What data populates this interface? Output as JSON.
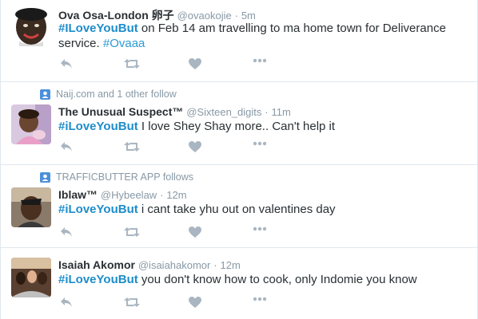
{
  "colors": {
    "text": "#292f33",
    "muted": "#8899a6",
    "hashtag": "#1d8dca",
    "icon": "#a9b6c1",
    "context_icon": "#4a90d9"
  },
  "tweets": [
    {
      "fullname": "Ova Osa-London 卵子",
      "username": "@ovaokojie",
      "dot": "·",
      "time": "5m",
      "hashtag": "#ILoveYouBut",
      "text": " on Feb 14 am travelling to ma home town for Deliverance service.  ",
      "hashtag2": "#Ovaaa",
      "icons": [
        "reply-icon",
        "retweet-icon",
        "favorite-icon",
        "more-icon"
      ]
    },
    {
      "context": "Naij.com and 1 other follow",
      "fullname": "The Unusual Suspect™",
      "username": "@Sixteen_digits",
      "dot": "·",
      "time": "11m",
      "hashtag": "#iLoveYouBut",
      "text": " I love Shey Shay more.. Can't help it",
      "icons": [
        "reply-icon",
        "retweet-icon",
        "favorite-icon",
        "more-icon"
      ]
    },
    {
      "context": "TRAFFICBUTTER APP follows",
      "fullname": "Iblaw™",
      "username": "@Hybeelaw",
      "dot": "·",
      "time": "12m",
      "hashtag": "#iLoveYouBut",
      "text": " i cant take yhu out on valentines day",
      "icons": [
        "reply-icon",
        "retweet-icon",
        "favorite-icon",
        "more-icon"
      ]
    },
    {
      "fullname": "Isaiah Akomor",
      "username": "@isaiahakomor",
      "dot": "·",
      "time": "12m",
      "hashtag": "#iLoveYouBut",
      "text": " you don't know how to cook, only Indomie you know",
      "icons": [
        "reply-icon",
        "retweet-icon",
        "favorite-icon",
        "more-icon"
      ]
    }
  ]
}
